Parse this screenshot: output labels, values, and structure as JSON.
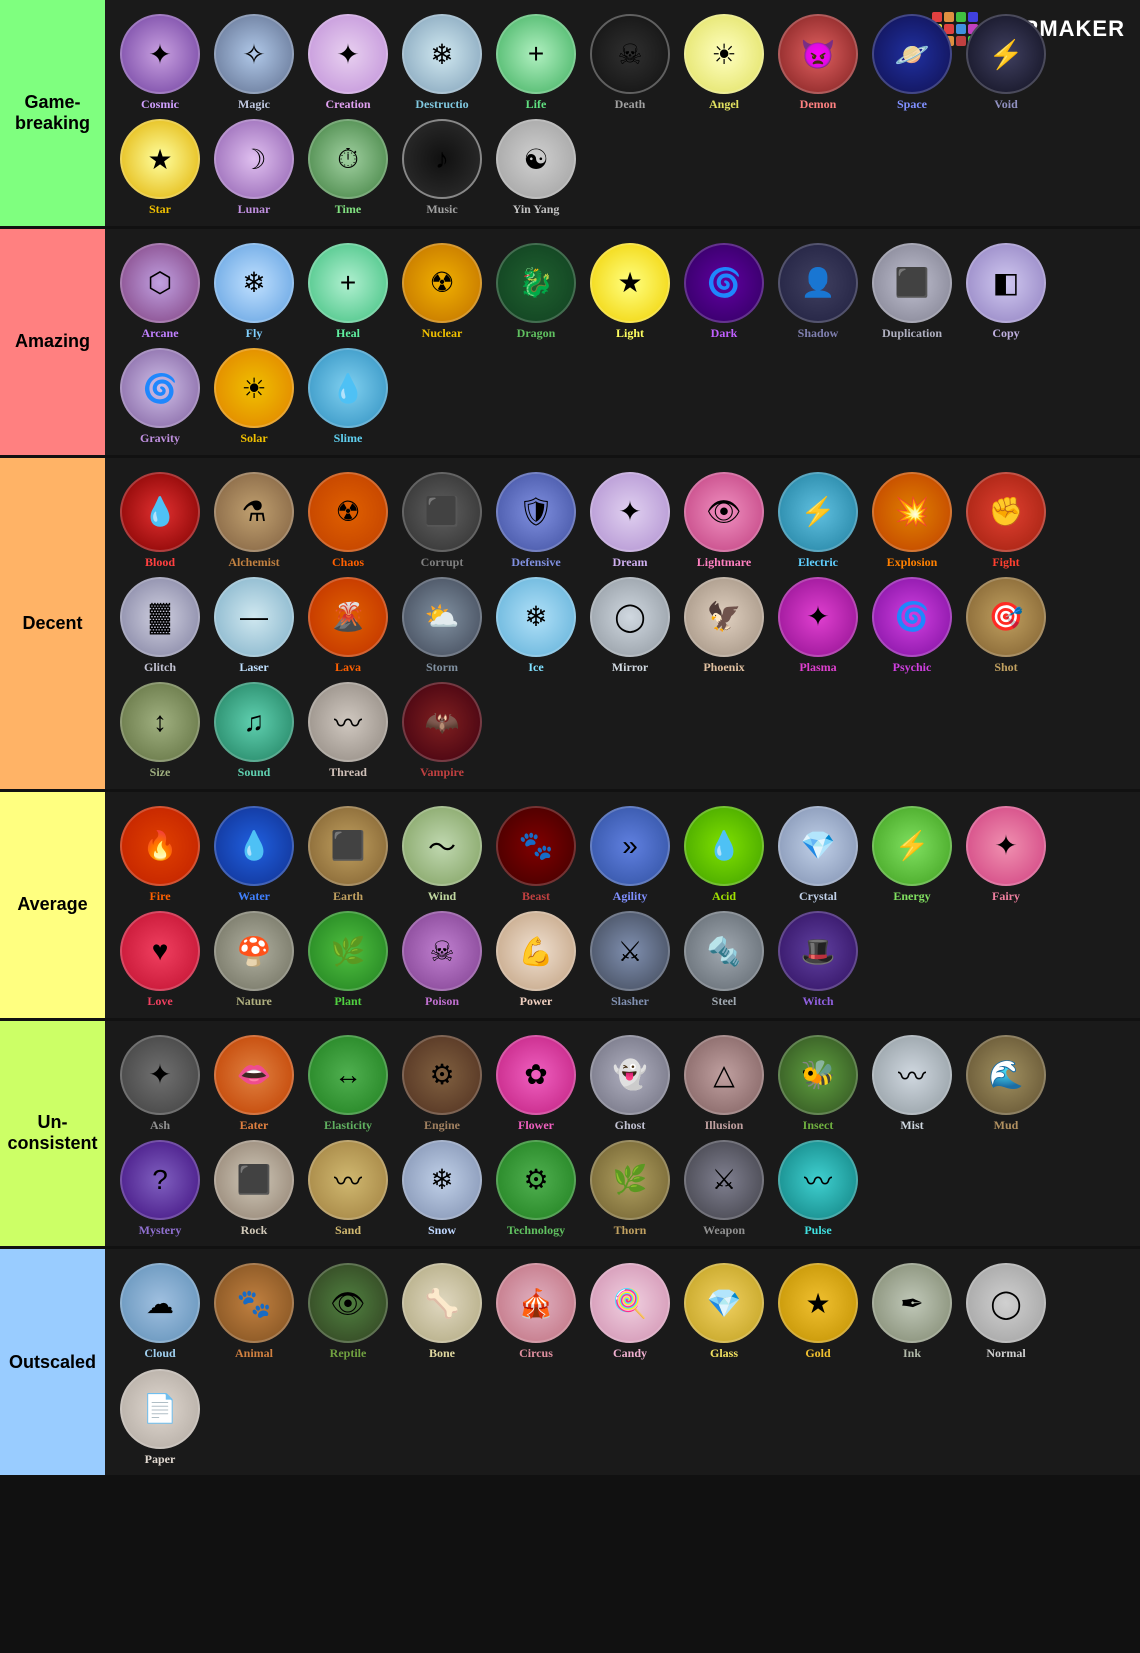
{
  "logo": {
    "text": "TiERMAKER",
    "highlight": "Ti"
  },
  "tiers": [
    {
      "id": "gamebreaking",
      "label": "Game-\nbreaking",
      "color": "tier-gamebreaking",
      "abilities": [
        {
          "name": "Cosmic",
          "class": "c-cosmic",
          "icon": "✦",
          "color": "#d0a0ff"
        },
        {
          "name": "Magic",
          "class": "c-magic",
          "icon": "✧",
          "color": "#c0c8e0"
        },
        {
          "name": "Creation",
          "class": "c-creation",
          "icon": "✦",
          "color": "#e0a0f0"
        },
        {
          "name": "Destructio",
          "class": "c-destruction",
          "icon": "❄",
          "color": "#80b0c8"
        },
        {
          "name": "Life",
          "class": "c-life",
          "icon": "+",
          "color": "#60e080"
        },
        {
          "name": "Death",
          "class": "c-death",
          "icon": "💀",
          "color": "#a0a0a0"
        },
        {
          "name": "Angel",
          "class": "c-angel",
          "icon": "☀",
          "color": "#e0e060"
        },
        {
          "name": "Demon",
          "class": "c-demon",
          "icon": "🔥",
          "color": "#ff6060"
        },
        {
          "name": "Space",
          "class": "c-space",
          "icon": "🪐",
          "color": "#8090ff"
        },
        {
          "name": "Void",
          "class": "c-void",
          "icon": "⚡",
          "color": "#8080c0"
        },
        {
          "name": "Star",
          "class": "c-star",
          "icon": "★",
          "color": "#f0c000"
        },
        {
          "name": "Lunar",
          "class": "c-lunar",
          "icon": "☽",
          "color": "#c090e0"
        },
        {
          "name": "Time",
          "class": "c-time",
          "icon": "⏱",
          "color": "#60c060"
        },
        {
          "name": "Music",
          "class": "c-music",
          "icon": "♪",
          "color": "#a0a0a0"
        },
        {
          "name": "Yin Yang",
          "class": "c-yinyang",
          "icon": "☯",
          "color": "#c0c0c0"
        }
      ]
    },
    {
      "id": "amazing",
      "label": "Amazing",
      "color": "tier-amazing",
      "abilities": [
        {
          "name": "Arcane",
          "class": "c-arcane",
          "icon": "✦",
          "color": "#d080ff"
        },
        {
          "name": "Fly",
          "class": "c-fly",
          "icon": "❄",
          "color": "#80d0ff"
        },
        {
          "name": "Heal",
          "class": "c-heal",
          "icon": "+",
          "color": "#60f0a0"
        },
        {
          "name": "Nuclear",
          "class": "c-nuclear",
          "icon": "☢",
          "color": "#f0c000"
        },
        {
          "name": "Dragon",
          "class": "c-dragon",
          "icon": "🐉",
          "color": "#60c060"
        },
        {
          "name": "Light",
          "class": "c-light",
          "icon": "★",
          "color": "#ffff60"
        },
        {
          "name": "Dark",
          "class": "c-dark",
          "icon": "🌀",
          "color": "#c060ff"
        },
        {
          "name": "Shadow",
          "class": "c-shadow",
          "icon": "👤",
          "color": "#8080a0"
        },
        {
          "name": "Duplication",
          "class": "c-duplication",
          "icon": "⬜",
          "color": "#b0b0c0"
        },
        {
          "name": "Copy",
          "class": "c-copy",
          "icon": "📋",
          "color": "#c0b0e0"
        },
        {
          "name": "Gravity",
          "class": "c-gravity",
          "icon": "🌀",
          "color": "#c090e0"
        },
        {
          "name": "Solar",
          "class": "c-solar",
          "icon": "☀",
          "color": "#f0c000"
        },
        {
          "name": "Slime",
          "class": "c-slime",
          "icon": "💧",
          "color": "#60d0f0"
        }
      ]
    },
    {
      "id": "decent",
      "label": "Decent",
      "color": "tier-decent",
      "abilities": [
        {
          "name": "Blood",
          "class": "c-blood",
          "icon": "💧",
          "color": "#ff4040"
        },
        {
          "name": "Alchemist",
          "class": "c-alchemist",
          "icon": "⚗",
          "color": "#c08040"
        },
        {
          "name": "Chaos",
          "class": "c-chaos",
          "icon": "☢",
          "color": "#ff6000"
        },
        {
          "name": "Corrupt",
          "class": "c-corrupt",
          "icon": "⬛",
          "color": "#808080"
        },
        {
          "name": "Defensive",
          "class": "c-defensive",
          "icon": "🛡",
          "color": "#8090e0"
        },
        {
          "name": "Dream",
          "class": "c-dream",
          "icon": "✦",
          "color": "#d0b0f0"
        },
        {
          "name": "Lightmare",
          "class": "c-lightmare",
          "icon": "👁",
          "color": "#ff80c0"
        },
        {
          "name": "Electric",
          "class": "c-electric",
          "icon": "⚡",
          "color": "#60d0ff"
        },
        {
          "name": "Explosion",
          "class": "c-explosion",
          "icon": "💥",
          "color": "#ff8000"
        },
        {
          "name": "Fight",
          "class": "c-fight",
          "icon": "✊",
          "color": "#ff4030"
        },
        {
          "name": "Glitch",
          "class": "c-glitch",
          "icon": "⬛",
          "color": "#c0c0d0"
        },
        {
          "name": "Laser",
          "class": "c-laser",
          "icon": "—",
          "color": "#c0e0ff"
        },
        {
          "name": "Lava",
          "class": "c-lava",
          "icon": "🌋",
          "color": "#ff6000"
        },
        {
          "name": "Storm",
          "class": "c-storm",
          "icon": "⛅",
          "color": "#8090a0"
        },
        {
          "name": "Ice",
          "class": "c-ice",
          "icon": "❄",
          "color": "#80e0ff"
        },
        {
          "name": "Mirror",
          "class": "c-mirror",
          "icon": "◯",
          "color": "#d0d8e0"
        },
        {
          "name": "Phoenix",
          "class": "c-phoenix",
          "icon": "🔥",
          "color": "#e0c0a0"
        },
        {
          "name": "Plasma",
          "class": "c-plasma",
          "icon": "✦",
          "color": "#e040d0"
        },
        {
          "name": "Psychic",
          "class": "c-psychic",
          "icon": "🌀",
          "color": "#d040e0"
        },
        {
          "name": "Shot",
          "class": "c-shot",
          "icon": "🎯",
          "color": "#c0a060"
        },
        {
          "name": "Size",
          "class": "c-size",
          "icon": "↕",
          "color": "#a0b080"
        },
        {
          "name": "Sound",
          "class": "c-sound",
          "icon": "♫",
          "color": "#60d0b0"
        },
        {
          "name": "Thread",
          "class": "c-thread",
          "icon": "∿",
          "color": "#d0c0b8"
        },
        {
          "name": "Vampire",
          "class": "c-vampire",
          "icon": "🦇",
          "color": "#c04040"
        }
      ]
    },
    {
      "id": "average",
      "label": "Average",
      "color": "tier-average",
      "abilities": [
        {
          "name": "Fire",
          "class": "c-fire",
          "icon": "🔥",
          "color": "#ff6000"
        },
        {
          "name": "Water",
          "class": "c-water",
          "icon": "💧",
          "color": "#4080ff"
        },
        {
          "name": "Earth",
          "class": "c-earth",
          "icon": "⬛",
          "color": "#c0a060"
        },
        {
          "name": "Wind",
          "class": "c-wind",
          "icon": "〜",
          "color": "#c0d8a0"
        },
        {
          "name": "Beast",
          "class": "c-beast",
          "icon": "🐾",
          "color": "#c04040"
        },
        {
          "name": "Agility",
          "class": "c-agility",
          "icon": "»",
          "color": "#8090ff"
        },
        {
          "name": "Acid",
          "class": "c-acid",
          "icon": "💧",
          "color": "#a0e000"
        },
        {
          "name": "Crystal",
          "class": "c-crystal",
          "icon": "💎",
          "color": "#c0d0e8"
        },
        {
          "name": "Energy",
          "class": "c-energy",
          "icon": "⚡",
          "color": "#80e060"
        },
        {
          "name": "Fairy",
          "class": "c-fairy",
          "icon": "✦",
          "color": "#f080a0"
        },
        {
          "name": "Love",
          "class": "c-love",
          "icon": "♥",
          "color": "#f04060"
        },
        {
          "name": "Nature",
          "class": "c-nature",
          "icon": "🍄",
          "color": "#b0b080"
        },
        {
          "name": "Plant",
          "class": "c-plant",
          "icon": "🌿",
          "color": "#50d040"
        },
        {
          "name": "Poison",
          "class": "c-poison",
          "icon": "☠",
          "color": "#c070d0"
        },
        {
          "name": "Power",
          "class": "c-power",
          "icon": "💪",
          "color": "#f0d0c0"
        },
        {
          "name": "Slasher",
          "class": "c-slasher",
          "icon": "⚔",
          "color": "#8090b0"
        },
        {
          "name": "Steel",
          "class": "c-steel",
          "icon": "🔩",
          "color": "#a0a8b0"
        },
        {
          "name": "Witch",
          "class": "c-witch",
          "icon": "🎩",
          "color": "#9060e0"
        }
      ]
    },
    {
      "id": "unconsistent",
      "label": "Un-\nconsistent",
      "color": "tier-unconsistent",
      "abilities": [
        {
          "name": "Ash",
          "class": "c-ash",
          "icon": "✦",
          "color": "#909090"
        },
        {
          "name": "Eater",
          "class": "c-eater",
          "icon": "👄",
          "color": "#e08040"
        },
        {
          "name": "Elasticity",
          "class": "c-elasticity",
          "icon": "↔",
          "color": "#60b060"
        },
        {
          "name": "Engine",
          "class": "c-engine",
          "icon": "⚙",
          "color": "#a08060"
        },
        {
          "name": "Flower",
          "class": "c-flower",
          "icon": "✿",
          "color": "#f060c0"
        },
        {
          "name": "Ghost",
          "class": "c-ghost",
          "icon": "👻",
          "color": "#c0c0d0"
        },
        {
          "name": "Illusion",
          "class": "c-illusion",
          "icon": "△",
          "color": "#c0a0a0"
        },
        {
          "name": "Insect",
          "class": "c-insect",
          "icon": "🐝",
          "color": "#70b040"
        },
        {
          "name": "Mist",
          "class": "c-mist",
          "icon": "〰",
          "color": "#d0d8e0"
        },
        {
          "name": "Mud",
          "class": "c-mud",
          "icon": "🌊",
          "color": "#b09060"
        },
        {
          "name": "Mystery",
          "class": "c-mystery",
          "icon": "?",
          "color": "#9070d0"
        },
        {
          "name": "Rock",
          "class": "c-rock",
          "icon": "⬛",
          "color": "#d0c8b8"
        },
        {
          "name": "Sand",
          "class": "c-sand",
          "icon": "〰",
          "color": "#d0b870"
        },
        {
          "name": "Snow",
          "class": "c-snow",
          "icon": "❄",
          "color": "#c0d8ff"
        },
        {
          "name": "Technology",
          "class": "c-technology",
          "icon": "⚙",
          "color": "#60c060"
        },
        {
          "name": "Thorn",
          "class": "c-thorn",
          "icon": "🌿",
          "color": "#c0a060"
        },
        {
          "name": "Weapon",
          "class": "c-weapon",
          "icon": "⚔",
          "color": "#909090"
        },
        {
          "name": "Pulse",
          "class": "c-pulse",
          "icon": "〰",
          "color": "#40e0e0"
        }
      ]
    },
    {
      "id": "outscaled",
      "label": "Outscaled",
      "color": "tier-outscaled",
      "abilities": [
        {
          "name": "Cloud",
          "class": "c-cloud",
          "icon": "☁",
          "color": "#a0d0f0"
        },
        {
          "name": "Animal",
          "class": "c-animal",
          "icon": "🐾",
          "color": "#d08040"
        },
        {
          "name": "Reptile",
          "class": "c-reptile",
          "icon": "👁",
          "color": "#70a040"
        },
        {
          "name": "Bone",
          "class": "c-bone",
          "icon": "🦴",
          "color": "#e0d8a0"
        },
        {
          "name": "Circus",
          "class": "c-circus",
          "icon": "🎪",
          "color": "#e090a0"
        },
        {
          "name": "Candy",
          "class": "c-candy",
          "icon": "🍭",
          "color": "#f0b0d0"
        },
        {
          "name": "Glass",
          "class": "c-glass",
          "icon": "💎",
          "color": "#f0e060"
        },
        {
          "name": "Gold",
          "class": "c-gold",
          "icon": "★",
          "color": "#f0c030"
        },
        {
          "name": "Ink",
          "class": "c-ink",
          "icon": "✒",
          "color": "#b0b8a8"
        },
        {
          "name": "Normal",
          "class": "c-normal",
          "icon": "◯",
          "color": "#d0d0d0"
        },
        {
          "name": "Paper",
          "class": "c-paper",
          "icon": "📄",
          "color": "#e0d8d0"
        }
      ]
    }
  ]
}
